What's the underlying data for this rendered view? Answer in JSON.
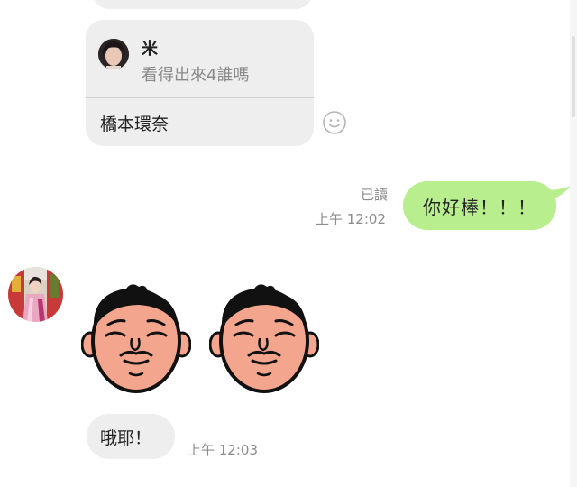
{
  "reply_message": {
    "quoted_sender": "米",
    "quoted_text": "看得出來4誰嗎",
    "text": "橋本環奈"
  },
  "outgoing_message": {
    "read_status": "已讀",
    "time": "上午 12:02",
    "text": "你好棒！！！"
  },
  "incoming_stickers": {
    "count": 2,
    "sticker_icon": "sleepy-face-sticker-icon"
  },
  "incoming_message": {
    "text": "哦耶！",
    "time": "上午 12:03"
  },
  "icons": {
    "emoji": "smiley-face-icon"
  },
  "colors": {
    "outgoing_bubble": "#b8ee8e",
    "incoming_bubble": "#eeeeee",
    "meta_text": "#8c8c8c",
    "background": "#ffffff"
  }
}
